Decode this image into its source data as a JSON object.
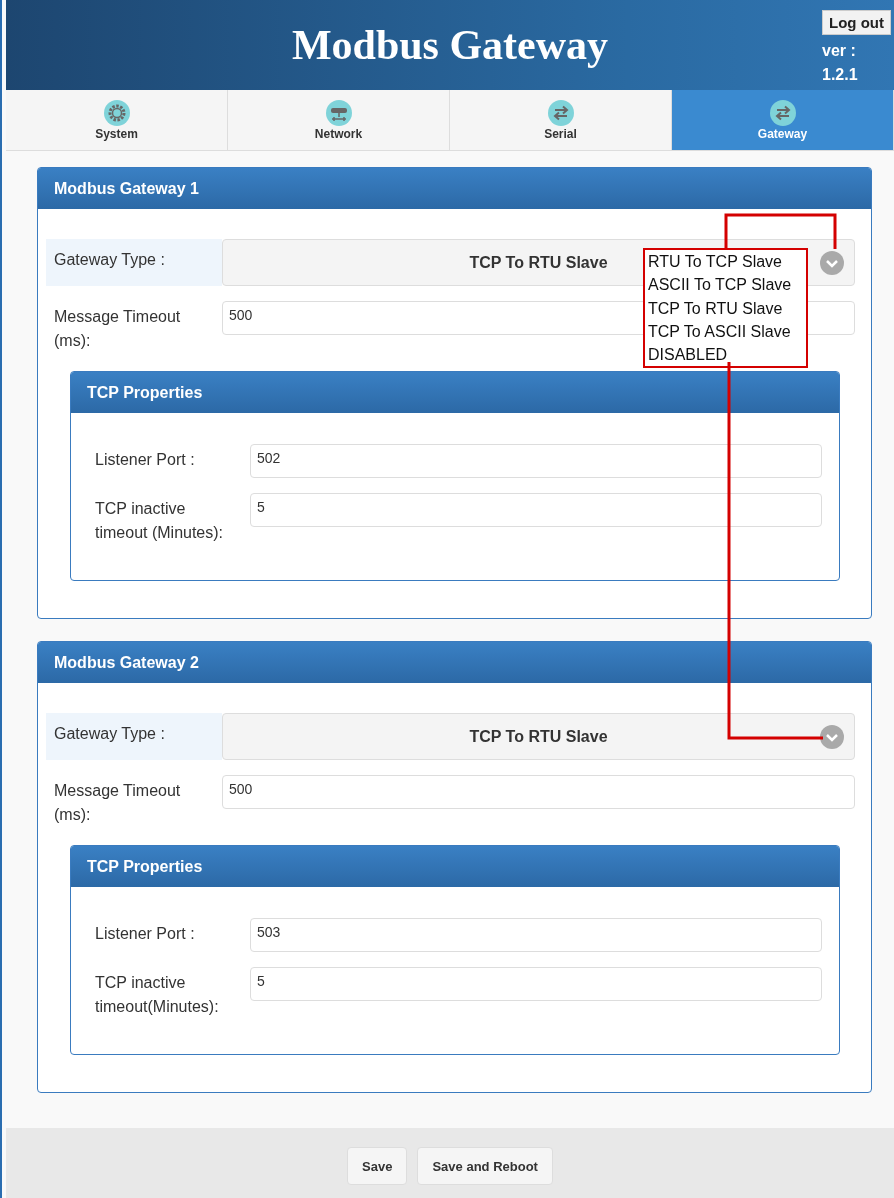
{
  "header": {
    "title": "Modbus Gateway",
    "logout_button": "Log out",
    "version_label": "ver :",
    "version": "1.2.1"
  },
  "tabs": [
    {
      "label": "System",
      "kind": "gear",
      "selected": false
    },
    {
      "label": "Network",
      "kind": "network",
      "selected": false
    },
    {
      "label": "Serial",
      "kind": "arrows",
      "selected": false
    },
    {
      "label": "Gateway",
      "kind": "arrows",
      "selected": true
    }
  ],
  "gateways": [
    {
      "title": "Modbus Gateway 1",
      "type_label": "Gateway Type :",
      "type": "TCP To RTU Slave",
      "timeout_label": "Message Timeout (ms):",
      "timeout": "500",
      "tcp": {
        "title": "TCP Properties",
        "port_label": "Listener Port :",
        "port": "502",
        "inactive_label": "TCP inactive timeout (Minutes):",
        "inactive": "5"
      }
    },
    {
      "title": "Modbus Gateway 2",
      "type_label": "Gateway Type :",
      "type": "TCP To RTU Slave",
      "timeout_label": "Message Timeout (ms):",
      "timeout": "500",
      "tcp": {
        "title": "TCP Properties",
        "port_label": "Listener Port :",
        "port": "503",
        "inactive_label": "TCP inactive timeout(Minutes):",
        "inactive": "5"
      }
    }
  ],
  "annotation": {
    "options": [
      "RTU To TCP Slave",
      "ASCII To TCP Slave",
      "TCP To RTU Slave",
      "TCP To ASCII Slave",
      "DISABLED"
    ]
  },
  "buttons": [
    "Save",
    "Save and Reboot"
  ]
}
